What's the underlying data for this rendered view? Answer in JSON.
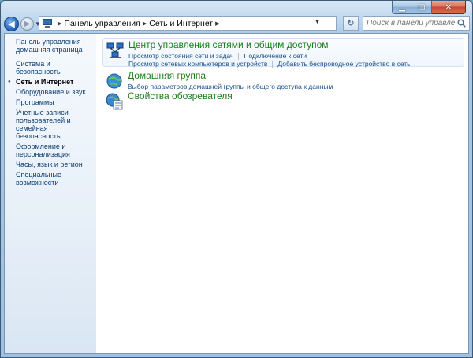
{
  "address": {
    "crumbs": [
      "Панель управления",
      "Сеть и Интернет"
    ]
  },
  "search": {
    "placeholder": "Поиск в панели управления"
  },
  "sidebar": {
    "home_line1": "Панель управления -",
    "home_line2": "домашняя страница",
    "items": [
      {
        "label": "Система и безопасность"
      },
      {
        "label": "Сеть и Интернет",
        "current": true
      },
      {
        "label": "Оборудование и звук"
      },
      {
        "label": "Программы"
      },
      {
        "label_lines": [
          "Учетные записи",
          "пользователей и семейная",
          "безопасность"
        ]
      },
      {
        "label_lines": [
          "Оформление и",
          "персонализация"
        ]
      },
      {
        "label": "Часы, язык и регион"
      },
      {
        "label": "Специальные возможности"
      }
    ]
  },
  "categories": [
    {
      "title": "Центр управления сетями и общим доступом",
      "tasks": [
        "Просмотр состояния сети и задач",
        "Подключение к сети",
        "Просмотр сетевых компьютеров и устройств",
        "Добавить беспроводное устройство в сеть"
      ]
    },
    {
      "title": "Домашняя группа",
      "tasks": [
        "Выбор параметров домашней группы и общего доступа к данным"
      ]
    },
    {
      "title": "Свойства обозревателя",
      "tasks": []
    }
  ],
  "colors": {
    "category_title": "#1e7d1e",
    "task_link": "#1c4f8a",
    "sidebar_link": "#0b3d73",
    "close_button": "#c44a2e"
  },
  "icons": [
    "back-arrow-icon",
    "forward-arrow-icon",
    "control-panel-icon",
    "refresh-icon",
    "search-icon",
    "network-center-icon",
    "homegroup-icon",
    "internet-options-icon"
  ]
}
